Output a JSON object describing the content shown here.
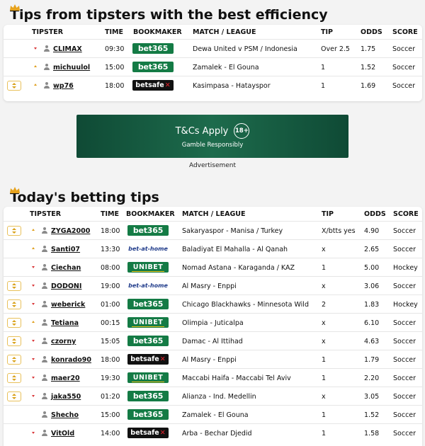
{
  "section1": {
    "title": "Tips from tipsters with the best efficiency",
    "headers": {
      "tipster": "TIPSTER",
      "time": "TIME",
      "bookmaker": "BOOKMAKER",
      "match": "MATCH / LEAGUE",
      "tip": "TIP",
      "odds": "ODDS",
      "score": "SCORE"
    },
    "rows": [
      {
        "fav": false,
        "trend": "down",
        "tipster": "CLIMAX",
        "time": "09:30",
        "bookmaker": "bet365",
        "match": "Dewa United v PSM / Indonesia",
        "tip": "Over 2.5",
        "odds": "1.75",
        "score": "Soccer"
      },
      {
        "fav": false,
        "trend": "up",
        "tipster": "michuulol",
        "time": "15:00",
        "bookmaker": "bet365",
        "match": "Zamalek - El Gouna",
        "tip": "1",
        "odds": "1.52",
        "score": "Soccer"
      },
      {
        "fav": true,
        "trend": "up",
        "tipster": "wp76",
        "time": "18:00",
        "bookmaker": "betsafe",
        "match": "Kasimpasa - Hatayspor",
        "tip": "1",
        "odds": "1.69",
        "score": "Soccer"
      }
    ]
  },
  "ad": {
    "text": "T&Cs Apply",
    "age": "18+",
    "sub": "Gamble Responsibly",
    "label": "Advertisement"
  },
  "section2": {
    "title": "Today's betting tips",
    "headers": {
      "tipster": "TIPSTER",
      "time": "TIME",
      "bookmaker": "BOOKMAKER",
      "match": "MATCH / LEAGUE",
      "tip": "TIP",
      "odds": "ODDS",
      "score": "SCORE"
    },
    "rows": [
      {
        "fav": true,
        "trend": "up",
        "tipster": "ZYGA2000",
        "time": "18:00",
        "bookmaker": "bet365",
        "match": "Sakaryaspor - Manisa / Turkey",
        "tip": "X/btts yes",
        "odds": "4.90",
        "score": "Soccer"
      },
      {
        "fav": false,
        "trend": "up",
        "tipster": "Santi07",
        "time": "13:30",
        "bookmaker": "bet-at-home",
        "match": "Baladiyat El Mahalla - Al Qanah",
        "tip": "x",
        "odds": "2.65",
        "score": "Soccer"
      },
      {
        "fav": false,
        "trend": "down",
        "tipster": "Ciechan",
        "time": "08:00",
        "bookmaker": "UNIBET",
        "match": "Nomad Astana - Karaganda / KAZ",
        "tip": "1",
        "odds": "5.00",
        "score": "Hockey"
      },
      {
        "fav": true,
        "trend": "down",
        "tipster": "DODONI",
        "time": "19:00",
        "bookmaker": "bet-at-home",
        "match": "Al Masry - Enppi",
        "tip": "x",
        "odds": "3.06",
        "score": "Soccer"
      },
      {
        "fav": true,
        "trend": "down",
        "tipster": "weberick",
        "time": "01:00",
        "bookmaker": "bet365",
        "match": "Chicago Blackhawks - Minnesota Wild",
        "tip": "2",
        "odds": "1.83",
        "score": "Hockey"
      },
      {
        "fav": true,
        "trend": "up",
        "tipster": "Tetiana",
        "time": "00:15",
        "bookmaker": "UNIBET",
        "match": "Olimpia - Juticalpa",
        "tip": "x",
        "odds": "6.10",
        "score": "Soccer"
      },
      {
        "fav": true,
        "trend": "down",
        "tipster": "czorny",
        "time": "15:05",
        "bookmaker": "bet365",
        "match": "Damac - Al Ittihad",
        "tip": "x",
        "odds": "4.63",
        "score": "Soccer"
      },
      {
        "fav": true,
        "trend": "down",
        "tipster": "konrado90",
        "time": "18:00",
        "bookmaker": "betsafe",
        "match": "Al Masry - Enppi",
        "tip": "1",
        "odds": "1.79",
        "score": "Soccer"
      },
      {
        "fav": true,
        "trend": "down",
        "tipster": "maer20",
        "time": "19:30",
        "bookmaker": "UNIBET",
        "match": "Maccabi Haifa - Maccabi Tel Aviv",
        "tip": "1",
        "odds": "2.20",
        "score": "Soccer"
      },
      {
        "fav": true,
        "trend": "down",
        "tipster": "jaka550",
        "time": "01:20",
        "bookmaker": "bet365",
        "match": "Alianza - Ind. Medellin",
        "tip": "x",
        "odds": "3.05",
        "score": "Soccer"
      },
      {
        "fav": false,
        "trend": "none",
        "tipster": "Shecho",
        "time": "15:00",
        "bookmaker": "bet365",
        "match": "Zamalek - El Gouna",
        "tip": "1",
        "odds": "1.52",
        "score": "Soccer"
      },
      {
        "fav": false,
        "trend": "down",
        "tipster": "VitOld",
        "time": "14:00",
        "bookmaker": "betsafe",
        "match": "Arba - Bechar Djedid",
        "tip": "1",
        "odds": "1.58",
        "score": "Soccer"
      }
    ]
  },
  "colors": {
    "bet365": "#147b45",
    "betsafe": "#111111",
    "unibet": "#147b45",
    "bet_at_home": "#1f3b8a",
    "trend_down": "#d9383a",
    "trend_up": "#e0a020",
    "favorite": "#d9a21b"
  }
}
